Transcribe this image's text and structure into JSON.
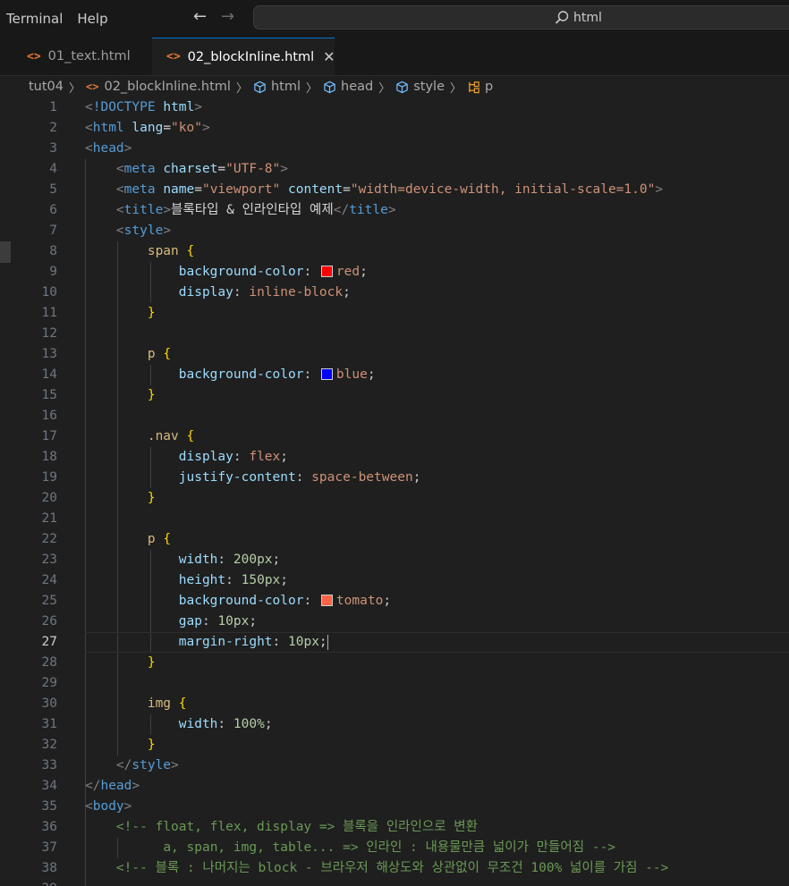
{
  "menu": [
    "Terminal",
    "Help"
  ],
  "search": {
    "text": "html"
  },
  "tabs": [
    {
      "icon": "<>",
      "label": "01_text.html"
    },
    {
      "icon": "<>",
      "label": "02_blockInline.html",
      "close": "✕"
    }
  ],
  "breadcrumb": [
    {
      "label": "tut04",
      "kind": "folder"
    },
    {
      "label": "02_blockInline.html",
      "kind": "html-file"
    },
    {
      "label": "html",
      "kind": "element"
    },
    {
      "label": "head",
      "kind": "element"
    },
    {
      "label": "style",
      "kind": "element"
    },
    {
      "label": "p",
      "kind": "selector"
    }
  ],
  "editor": {
    "active_line": 27,
    "lines": [
      [
        [
          "t-br",
          "<"
        ],
        [
          "t-tag",
          "!DOCTYPE"
        ],
        [
          "t-tx",
          " "
        ],
        [
          "t-at",
          "html"
        ],
        [
          "t-br",
          ">"
        ]
      ],
      [
        [
          "t-br",
          "<"
        ],
        [
          "t-tag",
          "html"
        ],
        [
          "t-tx",
          " "
        ],
        [
          "t-at",
          "lang"
        ],
        [
          "t-tx",
          "="
        ],
        [
          "t-st",
          "\"ko\""
        ],
        [
          "t-br",
          ">"
        ]
      ],
      [
        [
          "t-br",
          "<"
        ],
        [
          "t-tag",
          "head"
        ],
        [
          "t-br",
          ">"
        ]
      ],
      [
        [
          "t-tx",
          "    "
        ],
        [
          "t-br",
          "<"
        ],
        [
          "t-tag",
          "meta"
        ],
        [
          "t-tx",
          " "
        ],
        [
          "t-at",
          "charset"
        ],
        [
          "t-tx",
          "="
        ],
        [
          "t-st",
          "\"UTF-8\""
        ],
        [
          "t-br",
          ">"
        ]
      ],
      [
        [
          "t-tx",
          "    "
        ],
        [
          "t-br",
          "<"
        ],
        [
          "t-tag",
          "meta"
        ],
        [
          "t-tx",
          " "
        ],
        [
          "t-at",
          "name"
        ],
        [
          "t-tx",
          "="
        ],
        [
          "t-st",
          "\"viewport\""
        ],
        [
          "t-tx",
          " "
        ],
        [
          "t-at",
          "content"
        ],
        [
          "t-tx",
          "="
        ],
        [
          "t-st",
          "\"width=device-width, initial-scale=1.0\""
        ],
        [
          "t-br",
          ">"
        ]
      ],
      [
        [
          "t-tx",
          "    "
        ],
        [
          "t-br",
          "<"
        ],
        [
          "t-tag",
          "title"
        ],
        [
          "t-br",
          ">"
        ],
        [
          "t-tx",
          "블록타입 & 인라인타입 예제"
        ],
        [
          "t-br",
          "</"
        ],
        [
          "t-tag",
          "title"
        ],
        [
          "t-br",
          ">"
        ]
      ],
      [
        [
          "t-tx",
          "    "
        ],
        [
          "t-br",
          "<"
        ],
        [
          "t-tag",
          "style"
        ],
        [
          "t-br",
          ">"
        ]
      ],
      [
        [
          "t-tx",
          "        "
        ],
        [
          "t-sel",
          "span"
        ],
        [
          "t-tx",
          " "
        ],
        [
          "t-brace",
          "{"
        ]
      ],
      [
        [
          "t-tx",
          "            "
        ],
        [
          "t-pr",
          "background-color"
        ],
        [
          "t-punc",
          ": "
        ],
        [
          "swatch",
          "#ff0000"
        ],
        [
          "t-vl",
          "red"
        ],
        [
          "t-punc",
          ";"
        ]
      ],
      [
        [
          "t-tx",
          "            "
        ],
        [
          "t-pr",
          "display"
        ],
        [
          "t-punc",
          ": "
        ],
        [
          "t-vl",
          "inline-block"
        ],
        [
          "t-punc",
          ";"
        ]
      ],
      [
        [
          "t-tx",
          "        "
        ],
        [
          "t-brace",
          "}"
        ]
      ],
      [],
      [
        [
          "t-tx",
          "        "
        ],
        [
          "t-sel",
          "p"
        ],
        [
          "t-tx",
          " "
        ],
        [
          "t-brace",
          "{"
        ]
      ],
      [
        [
          "t-tx",
          "            "
        ],
        [
          "t-pr",
          "background-color"
        ],
        [
          "t-punc",
          ": "
        ],
        [
          "swatch",
          "#0000ff"
        ],
        [
          "t-vl",
          "blue"
        ],
        [
          "t-punc",
          ";"
        ]
      ],
      [
        [
          "t-tx",
          "        "
        ],
        [
          "t-brace",
          "}"
        ]
      ],
      [],
      [
        [
          "t-tx",
          "        "
        ],
        [
          "t-sel",
          ".nav"
        ],
        [
          "t-tx",
          " "
        ],
        [
          "t-brace",
          "{"
        ]
      ],
      [
        [
          "t-tx",
          "            "
        ],
        [
          "t-pr",
          "display"
        ],
        [
          "t-punc",
          ": "
        ],
        [
          "t-vl",
          "flex"
        ],
        [
          "t-punc",
          ";"
        ]
      ],
      [
        [
          "t-tx",
          "            "
        ],
        [
          "t-pr",
          "justify-content"
        ],
        [
          "t-punc",
          ": "
        ],
        [
          "t-vl",
          "space-between"
        ],
        [
          "t-punc",
          ";"
        ]
      ],
      [
        [
          "t-tx",
          "        "
        ],
        [
          "t-brace",
          "}"
        ]
      ],
      [],
      [
        [
          "t-tx",
          "        "
        ],
        [
          "t-sel",
          "p"
        ],
        [
          "t-tx",
          " "
        ],
        [
          "t-brace",
          "{"
        ]
      ],
      [
        [
          "t-tx",
          "            "
        ],
        [
          "t-pr",
          "width"
        ],
        [
          "t-punc",
          ": "
        ],
        [
          "t-num",
          "200px"
        ],
        [
          "t-punc",
          ";"
        ]
      ],
      [
        [
          "t-tx",
          "            "
        ],
        [
          "t-pr",
          "height"
        ],
        [
          "t-punc",
          ": "
        ],
        [
          "t-num",
          "150px"
        ],
        [
          "t-punc",
          ";"
        ]
      ],
      [
        [
          "t-tx",
          "            "
        ],
        [
          "t-pr",
          "background-color"
        ],
        [
          "t-punc",
          ": "
        ],
        [
          "swatch",
          "#ff6347"
        ],
        [
          "t-vl",
          "tomato"
        ],
        [
          "t-punc",
          ";"
        ]
      ],
      [
        [
          "t-tx",
          "            "
        ],
        [
          "t-pr",
          "gap"
        ],
        [
          "t-punc",
          ": "
        ],
        [
          "t-num",
          "10px"
        ],
        [
          "t-punc",
          ";"
        ]
      ],
      [
        [
          "t-tx",
          "            "
        ],
        [
          "t-pr",
          "margin-right"
        ],
        [
          "t-punc",
          ": "
        ],
        [
          "t-num",
          "10px"
        ],
        [
          "t-punc",
          ";"
        ],
        [
          "caret",
          ""
        ]
      ],
      [
        [
          "t-tx",
          "        "
        ],
        [
          "t-brace",
          "}"
        ]
      ],
      [],
      [
        [
          "t-tx",
          "        "
        ],
        [
          "t-sel",
          "img"
        ],
        [
          "t-tx",
          " "
        ],
        [
          "t-brace",
          "{"
        ]
      ],
      [
        [
          "t-tx",
          "            "
        ],
        [
          "t-pr",
          "width"
        ],
        [
          "t-punc",
          ": "
        ],
        [
          "t-num",
          "100%"
        ],
        [
          "t-punc",
          ";"
        ]
      ],
      [
        [
          "t-tx",
          "        "
        ],
        [
          "t-brace",
          "}"
        ]
      ],
      [
        [
          "t-tx",
          "    "
        ],
        [
          "t-br",
          "</"
        ],
        [
          "t-tag",
          "style"
        ],
        [
          "t-br",
          ">"
        ]
      ],
      [
        [
          "t-br",
          "</"
        ],
        [
          "t-tag",
          "head"
        ],
        [
          "t-br",
          ">"
        ]
      ],
      [
        [
          "t-br",
          "<"
        ],
        [
          "t-tag",
          "body"
        ],
        [
          "t-br",
          ">"
        ]
      ],
      [
        [
          "t-tx",
          "    "
        ],
        [
          "t-cm",
          "<!-- float, flex, display => 블록을 인라인으로 변환"
        ]
      ],
      [
        [
          "t-tx",
          "          "
        ],
        [
          "t-cm",
          "a, span, img, table... => 인라인 : 내용물만큼 넓이가 만들어짐 -->"
        ]
      ],
      [
        [
          "t-tx",
          "    "
        ],
        [
          "t-cm",
          "<!-- 블록 : 나머지는 block - 브라우저 해상도와 상관없이 무조건 100% 넓이를 가짐 -->"
        ]
      ],
      []
    ]
  },
  "colors": {
    "background": "#1f1f1f",
    "accent": "#0078d4",
    "html_icon": "#e37933"
  }
}
